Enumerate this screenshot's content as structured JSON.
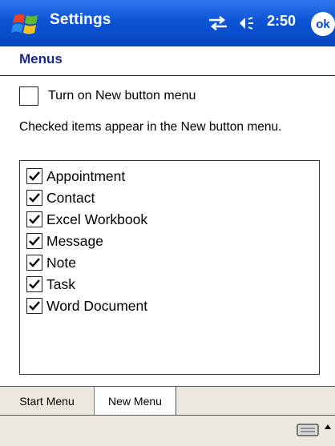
{
  "titlebar": {
    "title": "Settings",
    "time": "2:50",
    "ok_label": "ok"
  },
  "page": {
    "title": "Menus"
  },
  "options": {
    "turn_on_label": "Turn on New button menu",
    "turn_on_checked": false,
    "description": "Checked items appear in the New button menu."
  },
  "list": {
    "items": [
      {
        "label": "Appointment",
        "checked": true
      },
      {
        "label": "Contact",
        "checked": true
      },
      {
        "label": "Excel Workbook",
        "checked": true
      },
      {
        "label": "Message",
        "checked": true
      },
      {
        "label": "Note",
        "checked": true
      },
      {
        "label": "Task",
        "checked": true
      },
      {
        "label": "Word Document",
        "checked": true
      }
    ]
  },
  "tabs": [
    {
      "label": "Start Menu",
      "active": false
    },
    {
      "label": "New Menu",
      "active": true
    }
  ],
  "icons": {
    "start": "windows-flag-icon",
    "connectivity": "connectivity-icon",
    "volume": "volume-icon",
    "keyboard": "keyboard-icon",
    "input_menu": "up-arrow-icon"
  },
  "colors": {
    "titlebar": "#0d55d6",
    "page_title": "#1a2a8c",
    "tab_bg": "#ece8e0"
  }
}
